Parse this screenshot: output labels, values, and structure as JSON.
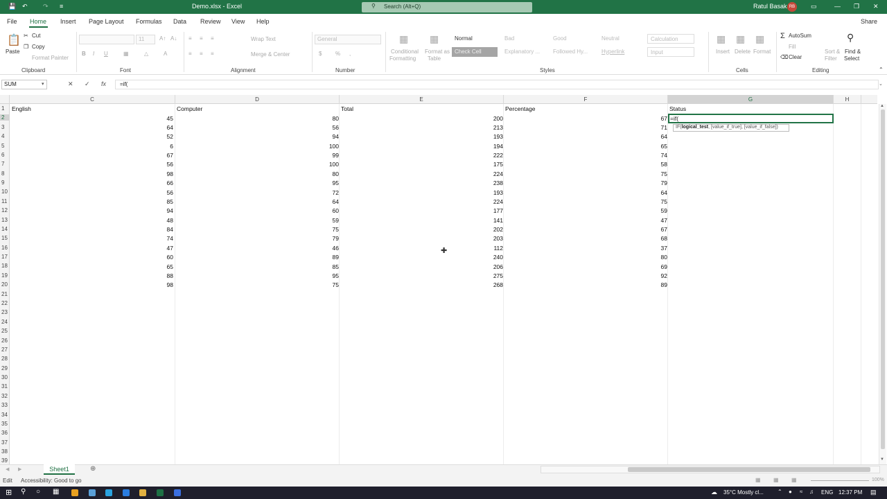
{
  "titlebar": {
    "file_title": "Demo.xlsx  -  Excel",
    "search_placeholder": "Search (Alt+Q)",
    "user_name": "Ratul Basak",
    "user_initials": "RB"
  },
  "menu": {
    "tabs": [
      "File",
      "Home",
      "Insert",
      "Page Layout",
      "Formulas",
      "Data",
      "Review",
      "View",
      "Help"
    ],
    "share": "Share"
  },
  "ribbon": {
    "clipboard": {
      "paste": "Paste",
      "cut": "Cut",
      "copy": "Copy",
      "format_painter": "Format Painter",
      "group": "Clipboard"
    },
    "font": {
      "group": "Font",
      "size": "11"
    },
    "alignment": {
      "wrap_text": "Wrap Text",
      "merge_center": "Merge & Center",
      "group": "Alignment"
    },
    "number": {
      "format": "General",
      "group": "Number"
    },
    "styles": {
      "conditional": "Conditional",
      "conditional2": "Formatting",
      "format_as": "Format as",
      "format_as2": "Table",
      "cells": [
        "Normal",
        "Bad",
        "Good",
        "Neutral",
        "Calculation",
        "Check Cell",
        "Explanatory ...",
        "Followed Hy...",
        "Hyperlink",
        "Input"
      ],
      "group": "Styles"
    },
    "cells": {
      "insert": "Insert",
      "delete": "Delete",
      "format": "Format",
      "group": "Cells"
    },
    "editing": {
      "autosum": "AutoSum",
      "fill": "Fill",
      "clear": "Clear",
      "sort": "Sort &",
      "sort2": "Filter",
      "find": "Find &",
      "find2": "Select",
      "group": "Editing"
    }
  },
  "formula_bar": {
    "name_box": "SUM",
    "formula": "=if("
  },
  "columns": [
    "C",
    "D",
    "E",
    "F",
    "G",
    "H"
  ],
  "headers": {
    "C": "English",
    "D": "Computer",
    "E": "Total",
    "F": "Percentage",
    "G": "Status"
  },
  "rows": [
    {
      "c": "45",
      "d": "80",
      "e": "200",
      "f": "67"
    },
    {
      "c": "64",
      "d": "56",
      "e": "213",
      "f": "71"
    },
    {
      "c": "52",
      "d": "94",
      "e": "193",
      "f": "64"
    },
    {
      "c": "6",
      "d": "100",
      "e": "194",
      "f": "65"
    },
    {
      "c": "67",
      "d": "99",
      "e": "222",
      "f": "74"
    },
    {
      "c": "56",
      "d": "100",
      "e": "175",
      "f": "58"
    },
    {
      "c": "98",
      "d": "80",
      "e": "224",
      "f": "75"
    },
    {
      "c": "66",
      "d": "95",
      "e": "238",
      "f": "79"
    },
    {
      "c": "56",
      "d": "72",
      "e": "193",
      "f": "64"
    },
    {
      "c": "85",
      "d": "64",
      "e": "224",
      "f": "75"
    },
    {
      "c": "94",
      "d": "60",
      "e": "177",
      "f": "59"
    },
    {
      "c": "48",
      "d": "59",
      "e": "141",
      "f": "47"
    },
    {
      "c": "84",
      "d": "75",
      "e": "202",
      "f": "67"
    },
    {
      "c": "74",
      "d": "79",
      "e": "203",
      "f": "68"
    },
    {
      "c": "47",
      "d": "46",
      "e": "112",
      "f": "37"
    },
    {
      "c": "60",
      "d": "89",
      "e": "240",
      "f": "80"
    },
    {
      "c": "65",
      "d": "85",
      "e": "206",
      "f": "69"
    },
    {
      "c": "88",
      "d": "95",
      "e": "275",
      "f": "92"
    },
    {
      "c": "98",
      "d": "75",
      "e": "268",
      "f": "89"
    }
  ],
  "active_cell_text": "=if(",
  "tooltip": {
    "fn": "IF(",
    "arg1": "logical_test",
    "rest": ", [value_if_true], [value_if_false])"
  },
  "row_numbers": [
    "1",
    "2",
    "3",
    "4",
    "5",
    "6",
    "7",
    "8",
    "9",
    "10",
    "11",
    "12",
    "13",
    "14",
    "15",
    "16",
    "17",
    "18",
    "19",
    "20",
    "21",
    "22",
    "23",
    "24",
    "25",
    "26",
    "27",
    "28",
    "29",
    "30",
    "31",
    "32",
    "33",
    "34",
    "35",
    "36",
    "37",
    "38",
    "39"
  ],
  "sheet": {
    "name": "Sheet1"
  },
  "status": {
    "mode": "Edit",
    "accessibility": "Accessibility: Good to go",
    "zoom": "100%"
  },
  "taskbar": {
    "weather": "35°C  Mostly cl...",
    "lang": "ENG",
    "time": "12:37 PM"
  }
}
